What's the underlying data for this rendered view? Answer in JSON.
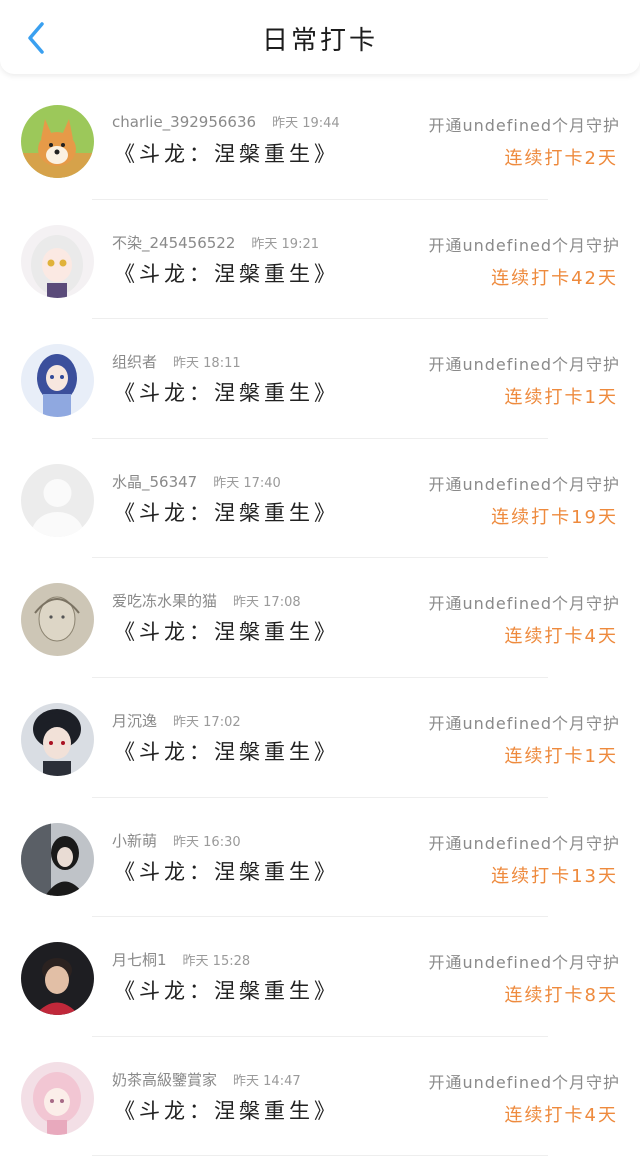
{
  "header": {
    "title": "日常打卡"
  },
  "colors": {
    "accent": "#3aa0f0",
    "streak": "#ee8a3d",
    "meta": "#8a8a8a"
  },
  "items": [
    {
      "user": "charlie_392956636",
      "time": "昨天 19:44",
      "work": "《斗龙：涅槃重生》",
      "guard": "开通undefined个月守护",
      "streak": "连续打卡2天",
      "avatar": "dog-avatar"
    },
    {
      "user": "不染_245456522",
      "time": "昨天 19:21",
      "work": "《斗龙：涅槃重生》",
      "guard": "开通undefined个月守护",
      "streak": "连续打卡42天",
      "avatar": "anime-girl-white-hair-avatar"
    },
    {
      "user": "组织者",
      "time": "昨天 18:11",
      "work": "《斗龙：涅槃重生》",
      "guard": "开通undefined个月守护",
      "streak": "连续打卡1天",
      "avatar": "anime-girl-blue-avatar"
    },
    {
      "user": "水晶_56347",
      "time": "昨天 17:40",
      "work": "《斗龙：涅槃重生》",
      "guard": "开通undefined个月守护",
      "streak": "连续打卡19天",
      "avatar": "default-avatar"
    },
    {
      "user": "爱吃冻水果的猫",
      "time": "昨天 17:08",
      "work": "《斗龙：涅槃重生》",
      "guard": "开通undefined个月守护",
      "streak": "连续打卡4天",
      "avatar": "sketch-avatar"
    },
    {
      "user": "月沉逸",
      "time": "昨天 17:02",
      "work": "《斗龙：涅槃重生》",
      "guard": "开通undefined个月守护",
      "streak": "连续打卡1天",
      "avatar": "anime-boy-avatar"
    },
    {
      "user": "小新萌",
      "time": "昨天 16:30",
      "work": "《斗龙：涅槃重生》",
      "guard": "开通undefined个月守护",
      "streak": "连续打卡13天",
      "avatar": "dark-photo-avatar"
    },
    {
      "user": "月七桐1",
      "time": "昨天 15:28",
      "work": "《斗龙：涅槃重生》",
      "guard": "开通undefined个月守护",
      "streak": "连续打卡8天",
      "avatar": "boy-photo-avatar"
    },
    {
      "user": "奶茶高級鑒賞家",
      "time": "昨天 14:47",
      "work": "《斗龙：涅槃重生》",
      "guard": "开通undefined个月守护",
      "streak": "连续打卡4天",
      "avatar": "pink-anime-avatar"
    }
  ]
}
